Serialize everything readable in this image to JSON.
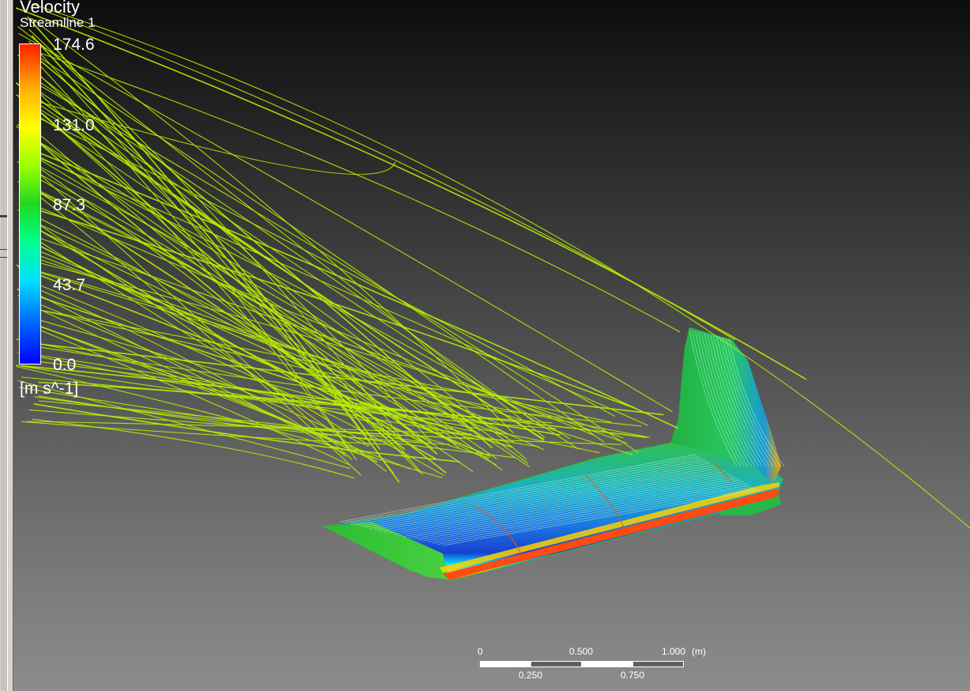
{
  "legend": {
    "title": "Velocity",
    "subtitle": "Streamline 1",
    "ticks": [
      "174.6",
      "131.0",
      "87.3",
      "43.7",
      "0.0"
    ],
    "unit": "[m s^-1]"
  },
  "scale_bar": {
    "top_labels": [
      "0",
      "0.500",
      "1.000",
      "(m)"
    ],
    "bottom_labels": [
      "0.250",
      "0.750"
    ],
    "segment_fills": [
      "#ffffff",
      "#606060",
      "#ffffff",
      "#606060"
    ]
  },
  "colors": {
    "streamline": "#b8f000",
    "background_top": "#0d0d0d",
    "background_bottom": "#8c8c8c",
    "leading_edge": "#ff5000",
    "surface_mid": "#1aa0e0",
    "surface_tip": "#30c040"
  }
}
